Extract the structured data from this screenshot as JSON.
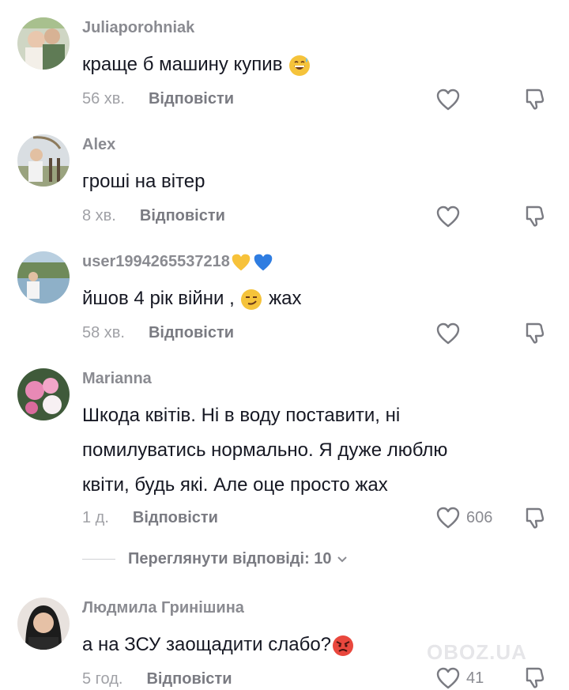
{
  "comments": [
    {
      "username": "Juliaporohniak",
      "text": "краще б машину купив",
      "emoji": "grinning-sweat-emoji",
      "time": "56 хв.",
      "reply_label": "Відповісти",
      "likes": ""
    },
    {
      "username": "Alex",
      "text": "гроші на вітер",
      "time": "8 хв.",
      "reply_label": "Відповісти",
      "likes": ""
    },
    {
      "username": "user1994265537218",
      "username_emojis": [
        "yellow-heart-emoji",
        "blue-heart-emoji"
      ],
      "text_before": "йшов 4 рік війни ,",
      "emoji": "smirking-face-emoji",
      "text_after": "жах",
      "time": "58 хв.",
      "reply_label": "Відповісти",
      "likes": ""
    },
    {
      "username": "Marianna",
      "text_lines": [
        "Шкода квітів. Ні в воду поставити, ні",
        "помилуватись нормально. Я дуже люблю",
        "квіти, будь які. Але оце просто жах"
      ],
      "time": "1 д.",
      "reply_label": "Відповісти",
      "likes": "606"
    },
    {
      "username": "Людмила Гринішина",
      "text": "а на ЗСУ заощадити слабо?",
      "emoji": "angry-face-emoji",
      "time": "5 год.",
      "reply_label": "Відповісти",
      "likes": "41"
    }
  ],
  "view_replies": {
    "label": "Переглянути відповіді: 10"
  },
  "watermark": "OBOZ.UA",
  "colors": {
    "username": "#8a8b91",
    "text": "#161823",
    "meta": "#a0a1a6"
  }
}
